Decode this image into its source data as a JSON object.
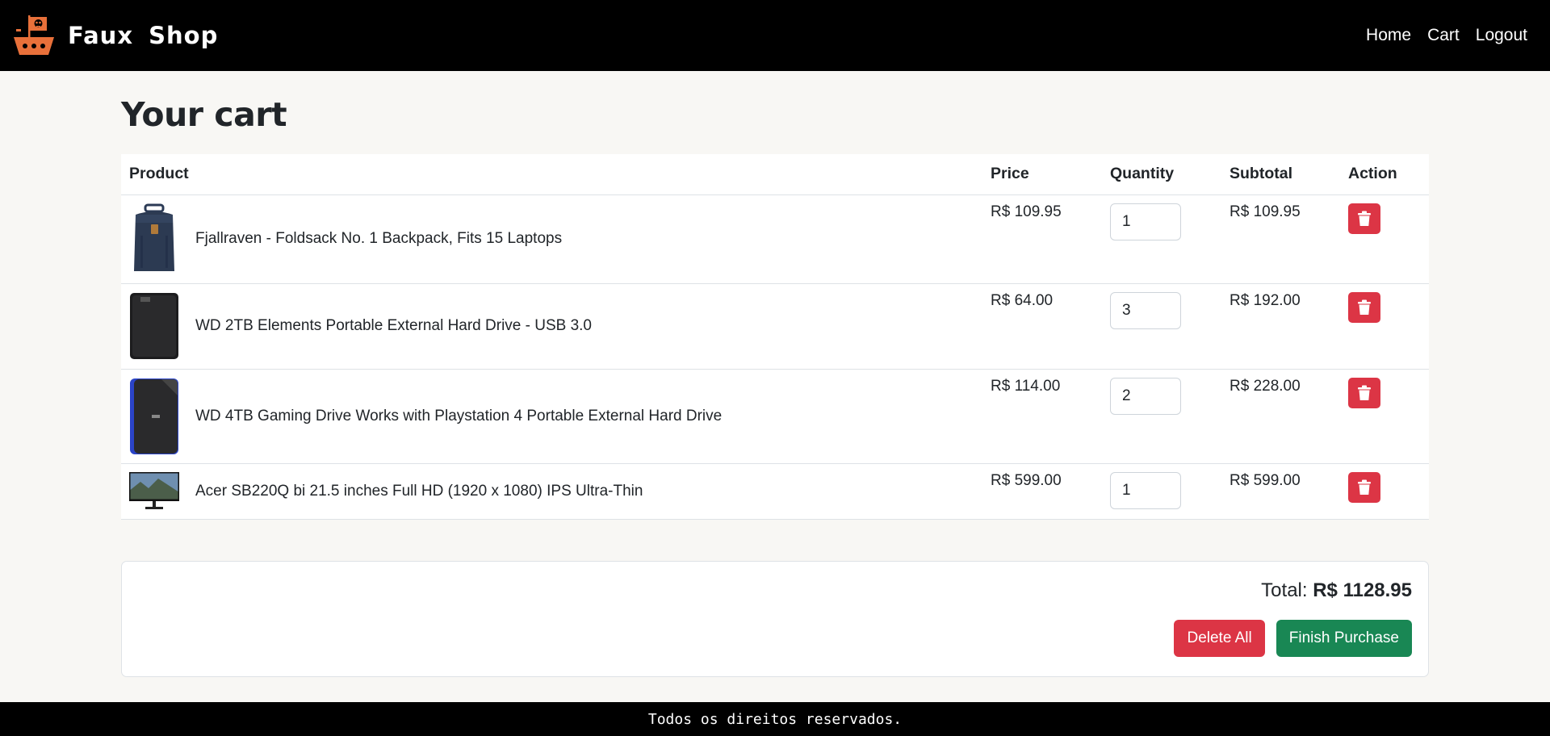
{
  "brand": {
    "name": "Faux Shop",
    "logo_icon": "pirate-ship-logo-icon"
  },
  "nav": {
    "items": [
      {
        "label": "Home"
      },
      {
        "label": "Cart"
      },
      {
        "label": "Logout"
      }
    ]
  },
  "page": {
    "title": "Your cart"
  },
  "table": {
    "headers": {
      "product": "Product",
      "price": "Price",
      "quantity": "Quantity",
      "subtotal": "Subtotal",
      "action": "Action"
    },
    "rows": [
      {
        "name": "Fjallraven - Foldsack No. 1 Backpack, Fits 15 Laptops",
        "price": "R$ 109.95",
        "quantity": "1",
        "subtotal": "R$ 109.95",
        "image_icon": "backpack-icon"
      },
      {
        "name": "WD 2TB Elements Portable External Hard Drive - USB 3.0",
        "price": "R$ 64.00",
        "quantity": "3",
        "subtotal": "R$ 192.00",
        "image_icon": "hard-drive-icon"
      },
      {
        "name": "WD 4TB Gaming Drive Works with Playstation 4 Portable External Hard Drive",
        "price": "R$ 114.00",
        "quantity": "2",
        "subtotal": "R$ 228.00",
        "image_icon": "gaming-drive-icon"
      },
      {
        "name": "Acer SB220Q bi 21.5 inches Full HD (1920 x 1080) IPS Ultra-Thin",
        "price": "R$ 599.00",
        "quantity": "1",
        "subtotal": "R$ 599.00",
        "image_icon": "monitor-icon"
      }
    ]
  },
  "summary": {
    "total_label": "Total:",
    "total_value": "R$ 1128.95",
    "delete_all_label": "Delete All",
    "finish_label": "Finish Purchase"
  },
  "footer": {
    "text": "Todos os direitos reservados."
  },
  "colors": {
    "danger": "#dc3545",
    "success": "#198754",
    "navbar": "#000000",
    "background": "#f8f7f4",
    "logo": "#e8703a"
  }
}
